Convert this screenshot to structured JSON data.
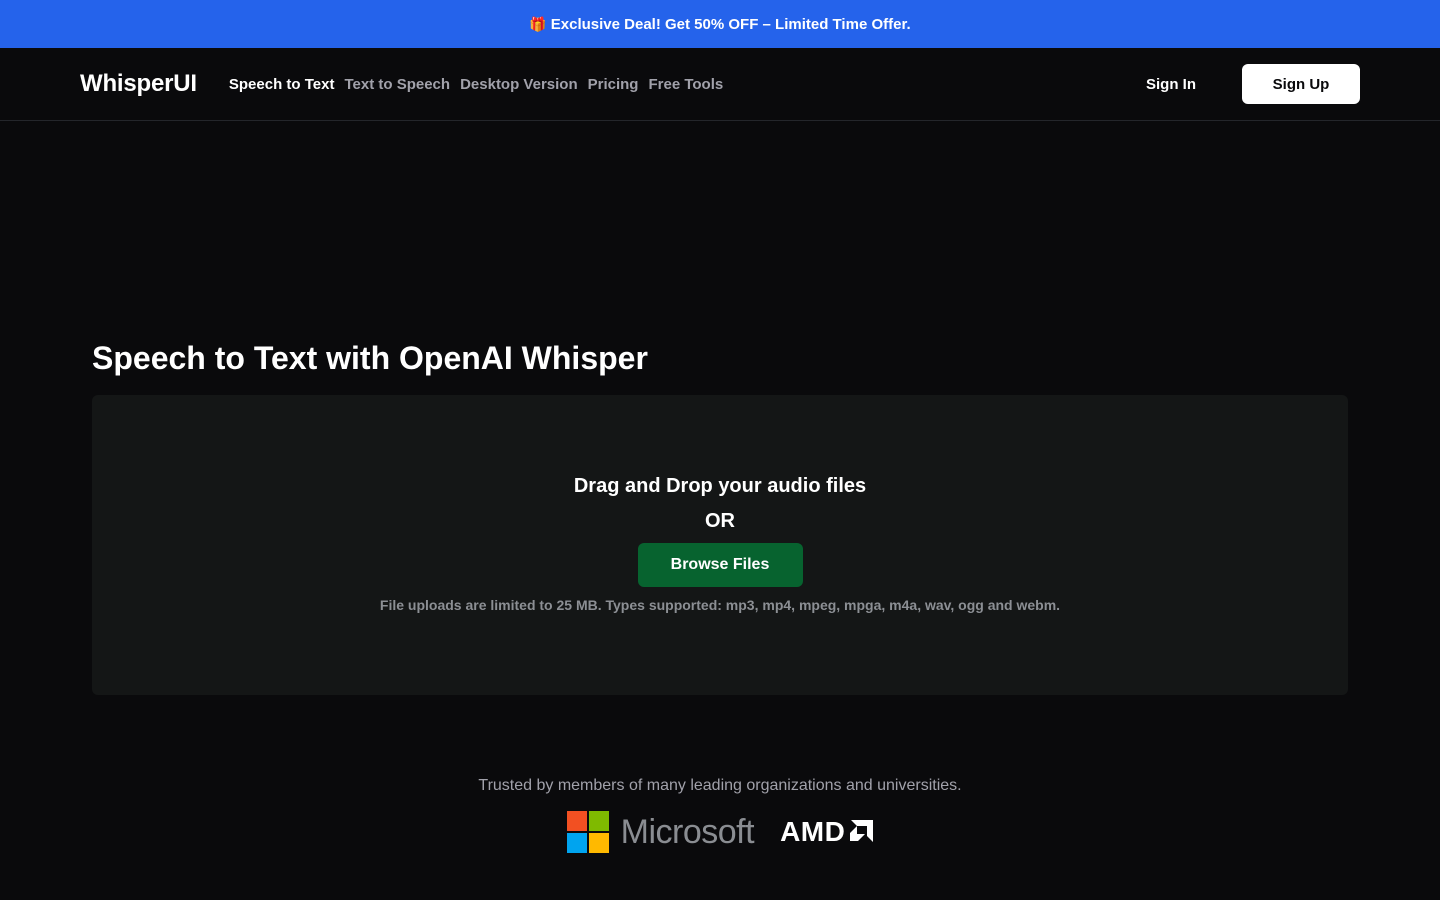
{
  "promo": {
    "icon": "gift-icon",
    "text": "Exclusive Deal! Get 50% OFF – Limited Time Offer."
  },
  "nav": {
    "logo": "WhisperUI",
    "links": [
      {
        "label": "Speech to Text",
        "active": true
      },
      {
        "label": "Text to Speech",
        "active": false
      },
      {
        "label": "Desktop Version",
        "active": false
      },
      {
        "label": "Pricing",
        "active": false
      },
      {
        "label": "Free Tools",
        "active": false
      }
    ],
    "sign_in": "Sign In",
    "sign_up": "Sign Up"
  },
  "main": {
    "title": "Speech to Text with OpenAI Whisper",
    "dropzone": {
      "heading": "Drag and Drop your audio files",
      "or": "OR",
      "browse_label": "Browse Files",
      "note": "File uploads are limited to 25 MB. Types supported: mp3, mp4, mpeg, mpga, m4a, wav, ogg and webm."
    }
  },
  "trusted": {
    "text": "Trusted by members of many leading organizations and universities.",
    "logos": [
      {
        "name": "Microsoft",
        "icon": "microsoft-logo"
      },
      {
        "name": "AMD",
        "icon": "amd-logo"
      }
    ]
  },
  "colors": {
    "promo_bg": "#2563eb",
    "page_bg": "#0a0a0c",
    "dropzone_bg": "#141616",
    "browse_bg": "#07632f",
    "ms_red": "#f25022",
    "ms_green": "#7fba00",
    "ms_blue": "#00a4ef",
    "ms_yellow": "#ffb900"
  }
}
